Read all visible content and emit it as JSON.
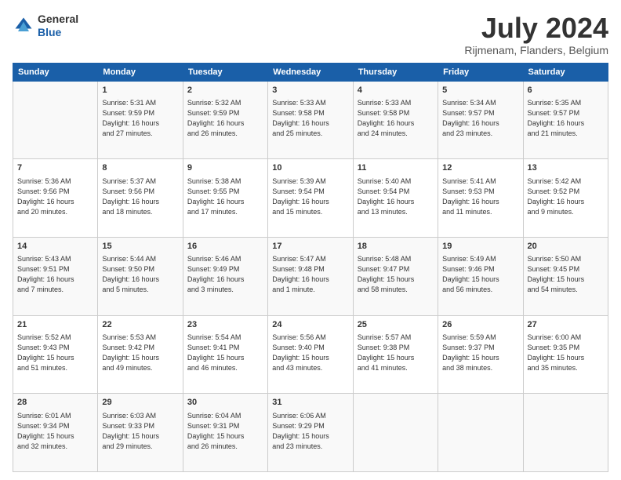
{
  "logo": {
    "general": "General",
    "blue": "Blue"
  },
  "header": {
    "month": "July 2024",
    "location": "Rijmenam, Flanders, Belgium"
  },
  "days": [
    "Sunday",
    "Monday",
    "Tuesday",
    "Wednesday",
    "Thursday",
    "Friday",
    "Saturday"
  ],
  "weeks": [
    [
      {
        "day": "",
        "info": ""
      },
      {
        "day": "1",
        "info": "Sunrise: 5:31 AM\nSunset: 9:59 PM\nDaylight: 16 hours\nand 27 minutes."
      },
      {
        "day": "2",
        "info": "Sunrise: 5:32 AM\nSunset: 9:59 PM\nDaylight: 16 hours\nand 26 minutes."
      },
      {
        "day": "3",
        "info": "Sunrise: 5:33 AM\nSunset: 9:58 PM\nDaylight: 16 hours\nand 25 minutes."
      },
      {
        "day": "4",
        "info": "Sunrise: 5:33 AM\nSunset: 9:58 PM\nDaylight: 16 hours\nand 24 minutes."
      },
      {
        "day": "5",
        "info": "Sunrise: 5:34 AM\nSunset: 9:57 PM\nDaylight: 16 hours\nand 23 minutes."
      },
      {
        "day": "6",
        "info": "Sunrise: 5:35 AM\nSunset: 9:57 PM\nDaylight: 16 hours\nand 21 minutes."
      }
    ],
    [
      {
        "day": "7",
        "info": "Sunrise: 5:36 AM\nSunset: 9:56 PM\nDaylight: 16 hours\nand 20 minutes."
      },
      {
        "day": "8",
        "info": "Sunrise: 5:37 AM\nSunset: 9:56 PM\nDaylight: 16 hours\nand 18 minutes."
      },
      {
        "day": "9",
        "info": "Sunrise: 5:38 AM\nSunset: 9:55 PM\nDaylight: 16 hours\nand 17 minutes."
      },
      {
        "day": "10",
        "info": "Sunrise: 5:39 AM\nSunset: 9:54 PM\nDaylight: 16 hours\nand 15 minutes."
      },
      {
        "day": "11",
        "info": "Sunrise: 5:40 AM\nSunset: 9:54 PM\nDaylight: 16 hours\nand 13 minutes."
      },
      {
        "day": "12",
        "info": "Sunrise: 5:41 AM\nSunset: 9:53 PM\nDaylight: 16 hours\nand 11 minutes."
      },
      {
        "day": "13",
        "info": "Sunrise: 5:42 AM\nSunset: 9:52 PM\nDaylight: 16 hours\nand 9 minutes."
      }
    ],
    [
      {
        "day": "14",
        "info": "Sunrise: 5:43 AM\nSunset: 9:51 PM\nDaylight: 16 hours\nand 7 minutes."
      },
      {
        "day": "15",
        "info": "Sunrise: 5:44 AM\nSunset: 9:50 PM\nDaylight: 16 hours\nand 5 minutes."
      },
      {
        "day": "16",
        "info": "Sunrise: 5:46 AM\nSunset: 9:49 PM\nDaylight: 16 hours\nand 3 minutes."
      },
      {
        "day": "17",
        "info": "Sunrise: 5:47 AM\nSunset: 9:48 PM\nDaylight: 16 hours\nand 1 minute."
      },
      {
        "day": "18",
        "info": "Sunrise: 5:48 AM\nSunset: 9:47 PM\nDaylight: 15 hours\nand 58 minutes."
      },
      {
        "day": "19",
        "info": "Sunrise: 5:49 AM\nSunset: 9:46 PM\nDaylight: 15 hours\nand 56 minutes."
      },
      {
        "day": "20",
        "info": "Sunrise: 5:50 AM\nSunset: 9:45 PM\nDaylight: 15 hours\nand 54 minutes."
      }
    ],
    [
      {
        "day": "21",
        "info": "Sunrise: 5:52 AM\nSunset: 9:43 PM\nDaylight: 15 hours\nand 51 minutes."
      },
      {
        "day": "22",
        "info": "Sunrise: 5:53 AM\nSunset: 9:42 PM\nDaylight: 15 hours\nand 49 minutes."
      },
      {
        "day": "23",
        "info": "Sunrise: 5:54 AM\nSunset: 9:41 PM\nDaylight: 15 hours\nand 46 minutes."
      },
      {
        "day": "24",
        "info": "Sunrise: 5:56 AM\nSunset: 9:40 PM\nDaylight: 15 hours\nand 43 minutes."
      },
      {
        "day": "25",
        "info": "Sunrise: 5:57 AM\nSunset: 9:38 PM\nDaylight: 15 hours\nand 41 minutes."
      },
      {
        "day": "26",
        "info": "Sunrise: 5:59 AM\nSunset: 9:37 PM\nDaylight: 15 hours\nand 38 minutes."
      },
      {
        "day": "27",
        "info": "Sunrise: 6:00 AM\nSunset: 9:35 PM\nDaylight: 15 hours\nand 35 minutes."
      }
    ],
    [
      {
        "day": "28",
        "info": "Sunrise: 6:01 AM\nSunset: 9:34 PM\nDaylight: 15 hours\nand 32 minutes."
      },
      {
        "day": "29",
        "info": "Sunrise: 6:03 AM\nSunset: 9:33 PM\nDaylight: 15 hours\nand 29 minutes."
      },
      {
        "day": "30",
        "info": "Sunrise: 6:04 AM\nSunset: 9:31 PM\nDaylight: 15 hours\nand 26 minutes."
      },
      {
        "day": "31",
        "info": "Sunrise: 6:06 AM\nSunset: 9:29 PM\nDaylight: 15 hours\nand 23 minutes."
      },
      {
        "day": "",
        "info": ""
      },
      {
        "day": "",
        "info": ""
      },
      {
        "day": "",
        "info": ""
      }
    ]
  ]
}
